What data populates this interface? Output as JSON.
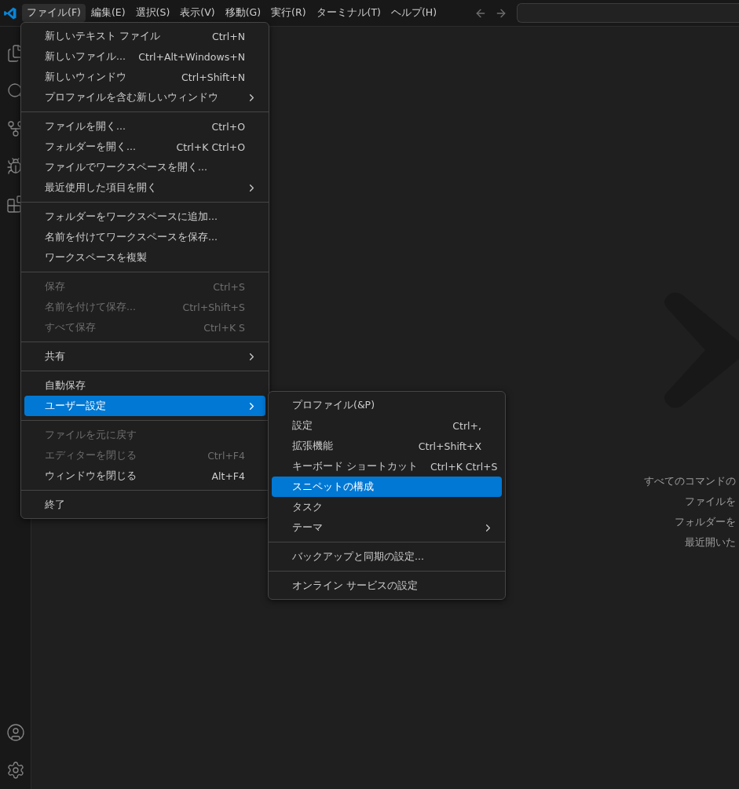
{
  "menubar": [
    {
      "label": "ファイル(F)",
      "selected": true
    },
    {
      "label": "編集(E)",
      "selected": false
    },
    {
      "label": "選択(S)",
      "selected": false
    },
    {
      "label": "表示(V)",
      "selected": false
    },
    {
      "label": "移動(G)",
      "selected": false
    },
    {
      "label": "実行(R)",
      "selected": false
    },
    {
      "label": "ターミナル(T)",
      "selected": false
    },
    {
      "label": "ヘルプ(H)",
      "selected": false
    }
  ],
  "file_menu": {
    "groups": [
      {
        "items": [
          {
            "label": "新しいテキスト ファイル",
            "shortcut": "Ctrl+N",
            "submenu": false,
            "disabled": false,
            "selected": false
          },
          {
            "label": "新しいファイル...",
            "shortcut": "Ctrl+Alt+Windows+N",
            "submenu": false,
            "disabled": false,
            "selected": false
          },
          {
            "label": "新しいウィンドウ",
            "shortcut": "Ctrl+Shift+N",
            "submenu": false,
            "disabled": false,
            "selected": false
          },
          {
            "label": "プロファイルを含む新しいウィンドウ",
            "submenu": true,
            "disabled": false,
            "selected": false
          }
        ]
      },
      {
        "items": [
          {
            "label": "ファイルを開く...",
            "shortcut": "Ctrl+O",
            "submenu": false,
            "disabled": false,
            "selected": false
          },
          {
            "label": "フォルダーを開く...",
            "shortcut": "Ctrl+K Ctrl+O",
            "submenu": false,
            "disabled": false,
            "selected": false
          },
          {
            "label": "ファイルでワークスペースを開く...",
            "submenu": false,
            "disabled": false,
            "selected": false
          },
          {
            "label": "最近使用した項目を開く",
            "submenu": true,
            "disabled": false,
            "selected": false
          }
        ]
      },
      {
        "items": [
          {
            "label": "フォルダーをワークスペースに追加...",
            "submenu": false,
            "disabled": false,
            "selected": false
          },
          {
            "label": "名前を付けてワークスペースを保存...",
            "submenu": false,
            "disabled": false,
            "selected": false
          },
          {
            "label": "ワークスペースを複製",
            "submenu": false,
            "disabled": false,
            "selected": false
          }
        ]
      },
      {
        "items": [
          {
            "label": "保存",
            "shortcut": "Ctrl+S",
            "submenu": false,
            "disabled": true,
            "selected": false
          },
          {
            "label": "名前を付けて保存...",
            "shortcut": "Ctrl+Shift+S",
            "submenu": false,
            "disabled": true,
            "selected": false
          },
          {
            "label": "すべて保存",
            "shortcut": "Ctrl+K S",
            "submenu": false,
            "disabled": true,
            "selected": false
          }
        ]
      },
      {
        "items": [
          {
            "label": "共有",
            "submenu": true,
            "disabled": false,
            "selected": false
          }
        ]
      },
      {
        "items": [
          {
            "label": "自動保存",
            "submenu": false,
            "disabled": false,
            "selected": false
          },
          {
            "label": "ユーザー設定",
            "submenu": true,
            "disabled": false,
            "selected": true
          }
        ]
      },
      {
        "items": [
          {
            "label": "ファイルを元に戻す",
            "submenu": false,
            "disabled": true,
            "selected": false
          },
          {
            "label": "エディターを閉じる",
            "shortcut": "Ctrl+F4",
            "submenu": false,
            "disabled": true,
            "selected": false
          },
          {
            "label": "ウィンドウを閉じる",
            "shortcut": "Alt+F4",
            "submenu": false,
            "disabled": false,
            "selected": false
          }
        ]
      },
      {
        "items": [
          {
            "label": "終了",
            "submenu": false,
            "disabled": false,
            "selected": false
          }
        ]
      }
    ]
  },
  "preferences_submenu": {
    "groups": [
      {
        "items": [
          {
            "label": "プロファイル(&P)",
            "submenu": false,
            "disabled": false,
            "selected": false
          },
          {
            "label": "設定",
            "shortcut": "Ctrl+,",
            "submenu": false,
            "disabled": false,
            "selected": false
          },
          {
            "label": "拡張機能",
            "shortcut": "Ctrl+Shift+X",
            "submenu": false,
            "disabled": false,
            "selected": false
          },
          {
            "label": "キーボード ショートカット",
            "shortcut": "Ctrl+K Ctrl+S",
            "submenu": false,
            "disabled": false,
            "selected": false
          },
          {
            "label": "スニペットの構成",
            "submenu": false,
            "disabled": false,
            "selected": true
          },
          {
            "label": "タスク",
            "submenu": false,
            "disabled": false,
            "selected": false
          },
          {
            "label": "テーマ",
            "submenu": true,
            "disabled": false,
            "selected": false
          }
        ]
      },
      {
        "items": [
          {
            "label": "バックアップと同期の設定...",
            "submenu": false,
            "disabled": false,
            "selected": false
          }
        ]
      },
      {
        "items": [
          {
            "label": "オンライン サービスの設定",
            "submenu": false,
            "disabled": false,
            "selected": false
          }
        ]
      }
    ]
  },
  "welcome_hints": [
    "すべてのコマンドの",
    "ファイルを",
    "フォルダーを",
    "最近開いた"
  ]
}
